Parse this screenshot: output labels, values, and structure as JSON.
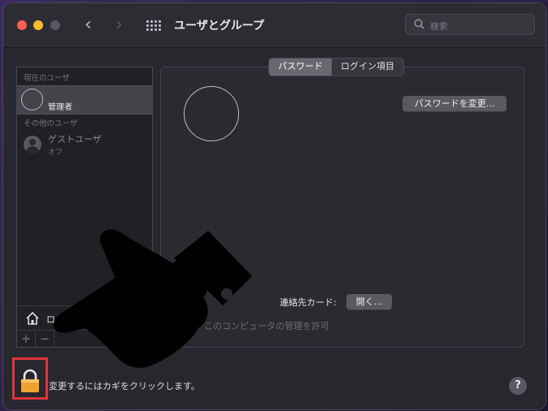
{
  "window": {
    "title": "ユーザとグループ"
  },
  "search": {
    "placeholder": "検索"
  },
  "sidebar": {
    "current_users_label": "現在のユーザ",
    "current_user": {
      "name": "管理者"
    },
    "other_users_label": "その他のユーザ",
    "guest": {
      "name": "ゲストユーザ",
      "status": "オフ"
    },
    "login_options_label": "ログ",
    "add_button": "+",
    "remove_button": "−"
  },
  "tabs": [
    {
      "label": "パスワード",
      "active": true
    },
    {
      "label": "ログイン項目",
      "active": false
    }
  ],
  "main": {
    "change_password_button": "パスワードを変更...",
    "contact_card_label": "連絡先カード:",
    "open_button": "開く...",
    "allow_admin_label": "このコンピュータの管理を許可"
  },
  "footer": {
    "lock_text": "変更するにはカギをクリックします。",
    "help_label": "?"
  },
  "colors": {
    "highlight_box": "#e0343a",
    "lock_body": "#f0a330"
  }
}
